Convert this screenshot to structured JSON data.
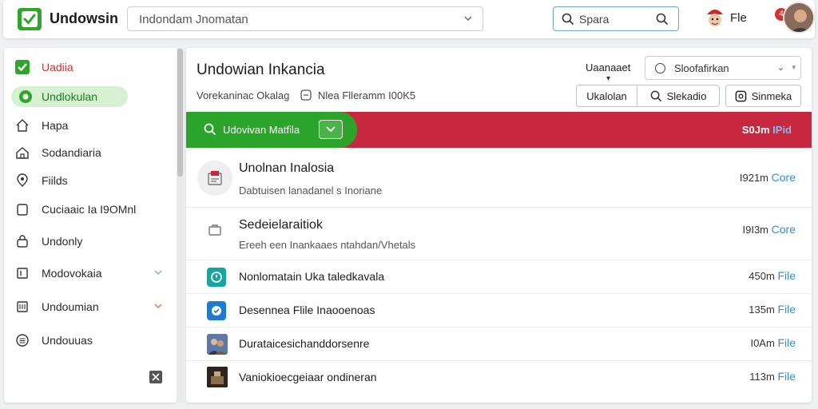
{
  "app": {
    "title": "Undowsin"
  },
  "header": {
    "search_value": "Indondam Jnomatan",
    "quick_search_label": "Spara",
    "user_name": "Fle",
    "notification_count": "4"
  },
  "sidebar": {
    "items": [
      {
        "label": "Uadiia",
        "icon": "check-box-icon"
      },
      {
        "label": "Undlokulan",
        "icon": "shield-icon"
      },
      {
        "label": "Hapa",
        "icon": "home-icon"
      },
      {
        "label": "Sodandiaria",
        "icon": "home-outline-icon"
      },
      {
        "label": "Fiilds",
        "icon": "pin-icon"
      },
      {
        "label": "Cuciaaic Ia I9OMnl",
        "icon": "folder-icon"
      },
      {
        "label": "Undonly",
        "icon": "lock-icon"
      },
      {
        "label": "Modovokaia",
        "icon": "square-icon"
      },
      {
        "label": "Undoumian",
        "icon": "calendar-icon"
      },
      {
        "label": "Undouuas",
        "icon": "list-circle-icon"
      }
    ]
  },
  "main": {
    "title": "Undowian Inkancia",
    "subtitle": "Vorekaninac Okalag",
    "subtitle2": "Nlea Flleramm I00K5",
    "filter_label": "Uaanaaet",
    "select_value": "Sloofafirkan",
    "btn_a": "Ukalolan",
    "btn_b": "Slekadio",
    "btn_c": "Sinmeka",
    "banner": {
      "label": "Udovivan Matfila",
      "right_prefix": "S0Jm",
      "right_suffix": "IPid"
    },
    "rows": [
      {
        "title": "Unolnan Inalosia",
        "desc": "Dabtuisen lanadanel s Inoriane",
        "meta": "I921m",
        "link": "Core"
      },
      {
        "title": "Sedeielaraitiok",
        "desc": "Ereeh een Inankaaes ntahdan/Vhetals",
        "meta": "I9I3m",
        "link": "Core"
      },
      {
        "title": "Nonlomatain Uka taledkavala",
        "desc": "",
        "meta": "450m",
        "link": "File"
      },
      {
        "title": "Desennea Flile Inaooenoas",
        "desc": "",
        "meta": "135m",
        "link": "File"
      },
      {
        "title": "Durataicesichanddorsenre",
        "desc": "",
        "meta": "I0Am",
        "link": "File"
      },
      {
        "title": "Vaniokioecgeiaar ondineran",
        "desc": "",
        "meta": "113m",
        "link": "File"
      }
    ]
  },
  "colors": {
    "brand_green": "#2fa52b",
    "banner_red": "#c8283f",
    "link_blue": "#2a8fd6",
    "active_bg": "#d5f1d2"
  }
}
